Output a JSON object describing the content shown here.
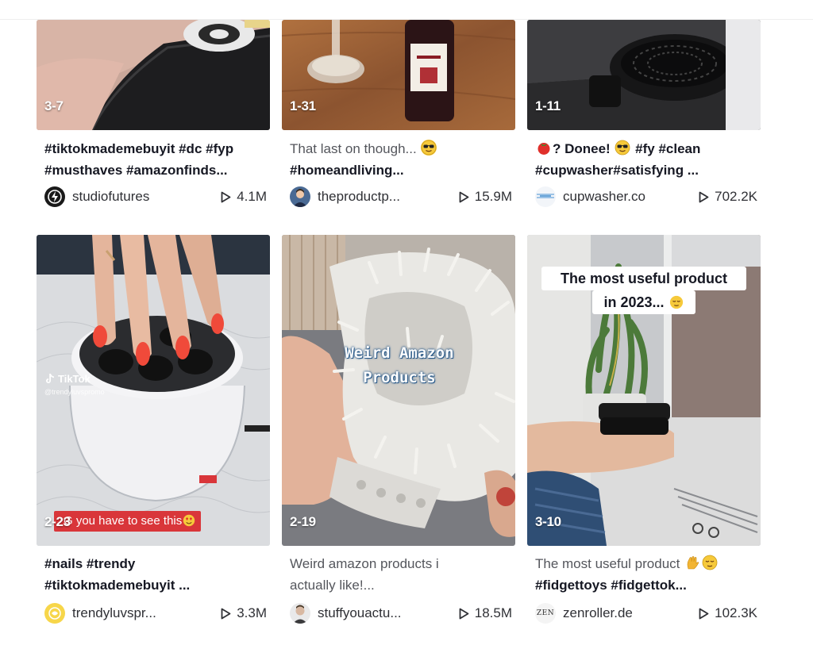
{
  "cards": [
    {
      "count": "3-7",
      "desc": [
        "#tiktokmademebuyit #dc #fyp",
        "#musthaves #amazonfinds..."
      ],
      "username": "studiofutures",
      "views": "4.1M",
      "avatar": "lightning-logo-icon"
    },
    {
      "count": "1-31",
      "desc": [
        "That last on though... ",
        "#homeandliving..."
      ],
      "username": "theproductp...",
      "views": "15.9M",
      "avatar": "person-avatar"
    },
    {
      "count": "1-11",
      "desc": [
        "? Donee! ",
        " #fy #clean",
        "#cupwasher#satisfying ..."
      ],
      "username": "cupwasher.co",
      "views": "702.2K",
      "avatar": "cupwasher-logo"
    },
    {
      "count": "2-23",
      "overlay": "G you have to see this",
      "watermark_brand": "TikTok",
      "watermark_handle": "@trendyluvspromo",
      "desc": [
        "#nails #trendy",
        "#tiktokmademebuyit ..."
      ],
      "username": "trendyluvspr...",
      "views": "3.3M",
      "avatar": "yellow-logo"
    },
    {
      "count": "2-19",
      "overlay_line1": "Weird Amazon",
      "overlay_line2": "Products",
      "desc": [
        "Weird amazon products i",
        "actually like!..."
      ],
      "username": "stuffyouactu...",
      "views": "18.5M",
      "avatar": "person-avatar"
    },
    {
      "count": "3-10",
      "overlay_line1": "The most useful product",
      "overlay_line2": "in 2023... ",
      "desc": [
        "The most useful product ",
        "#fidgettoys #fidgettok..."
      ],
      "username": "zenroller.de",
      "views": "102.3K",
      "avatar_text": "ZEN"
    }
  ],
  "colors": {
    "text_primary": "#161823",
    "text_secondary": "#54565c",
    "meta_text": "#2f3035",
    "overlay_red": "#d9363a"
  }
}
